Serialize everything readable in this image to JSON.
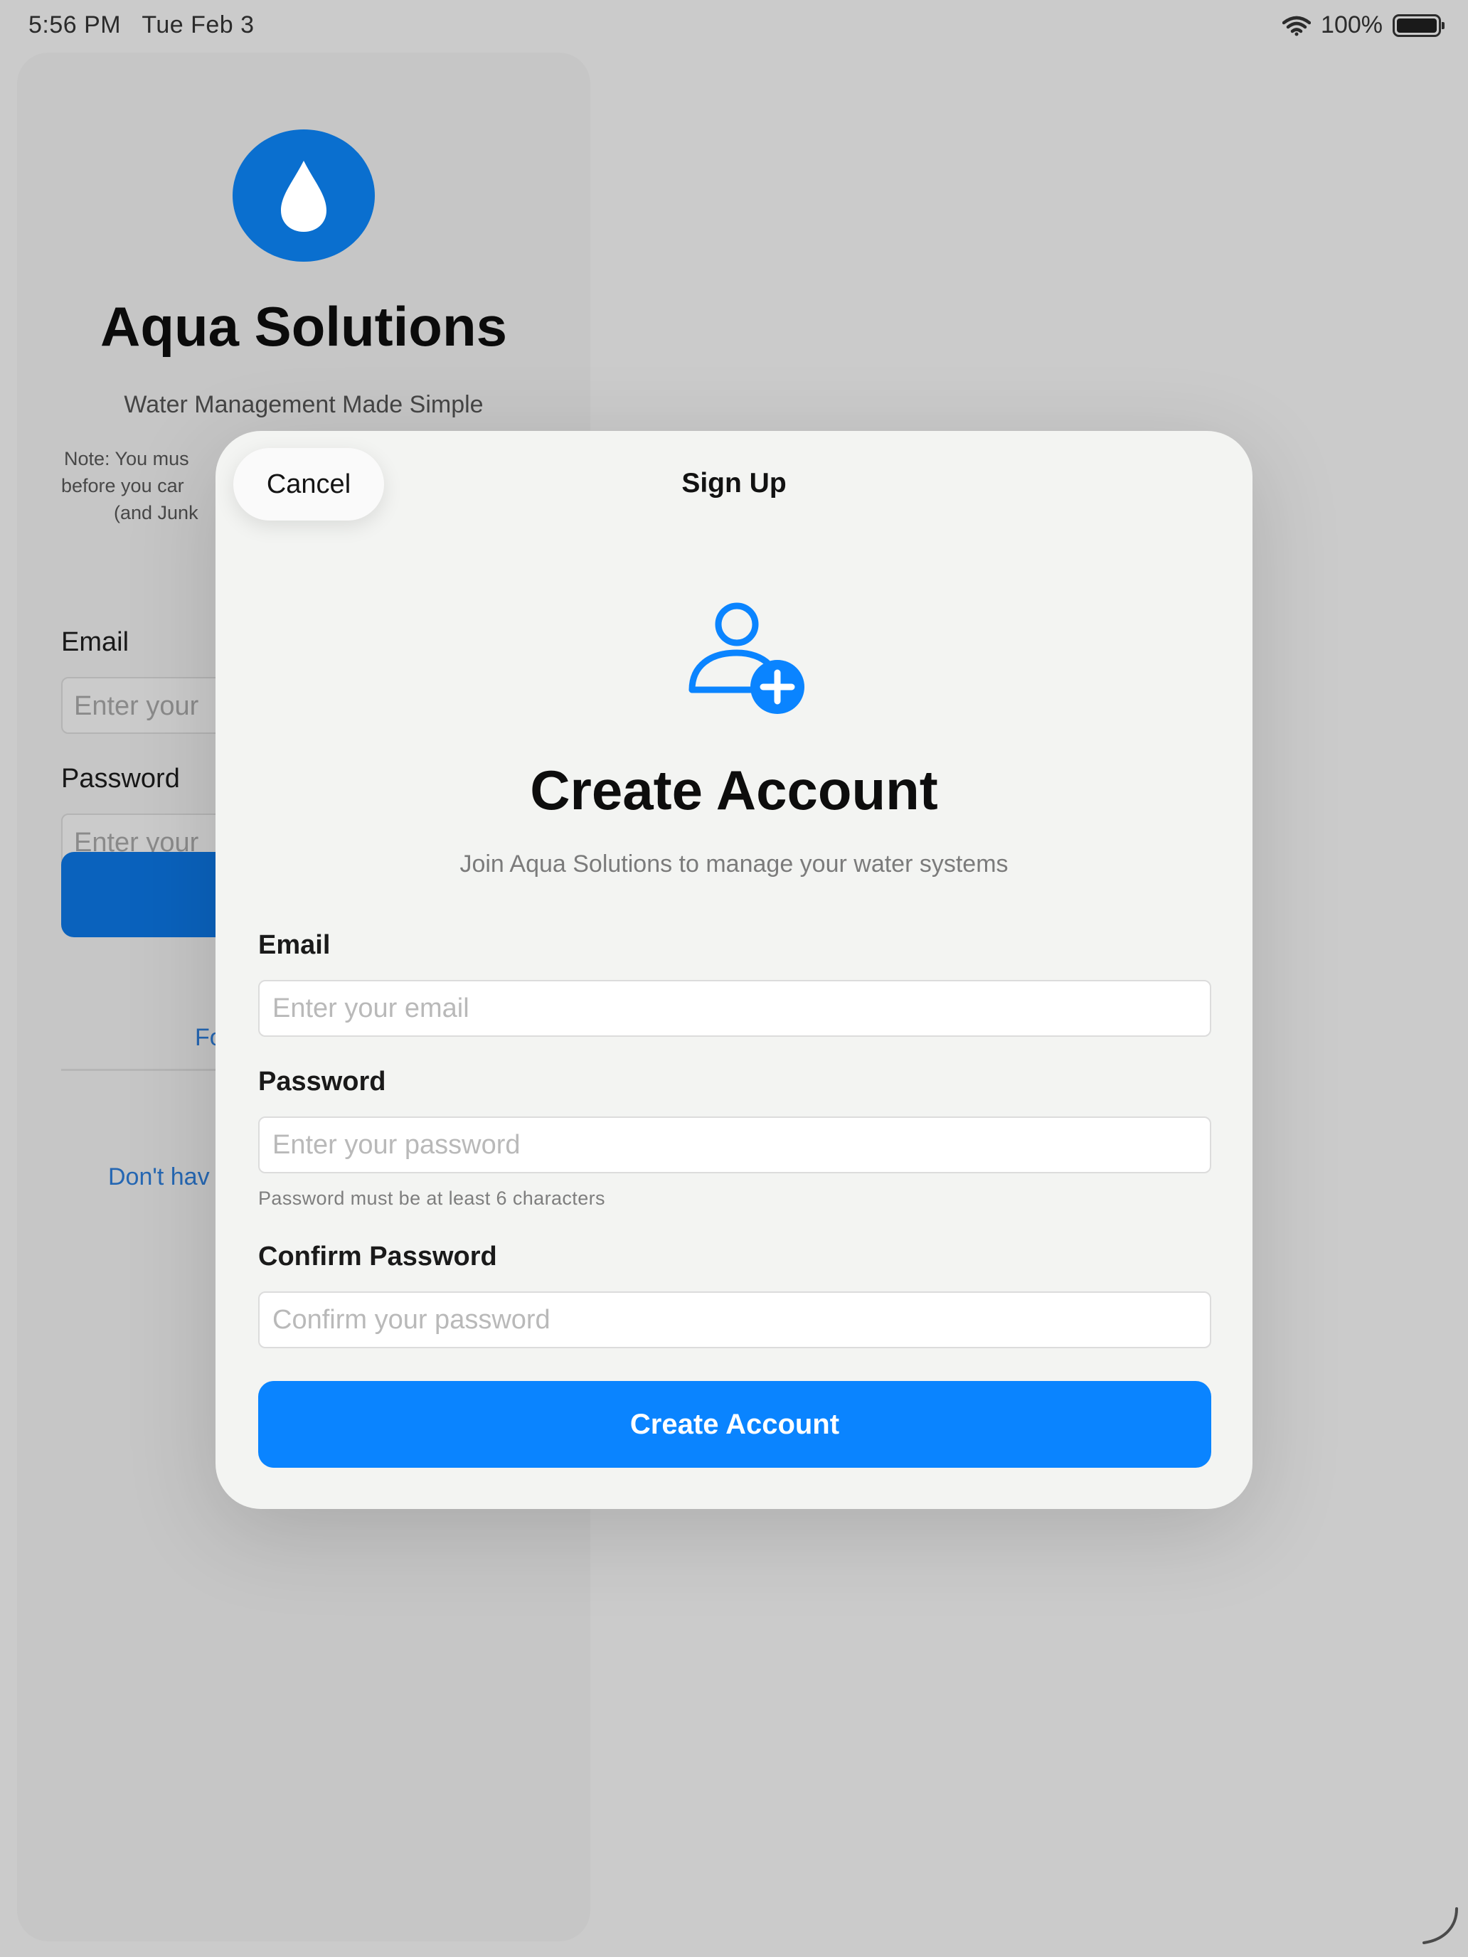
{
  "status_bar": {
    "time": "5:56 PM",
    "date": "Tue Feb 3",
    "battery": "100%"
  },
  "login": {
    "app_title": "Aqua Solutions",
    "subtitle": "Water Management Made Simple",
    "note_lines": [
      "Note: You mus",
      "before you car",
      "(and Junk"
    ],
    "email_label": "Email",
    "email_placeholder": "Enter your",
    "password_label": "Password",
    "password_placeholder": "Enter your",
    "forgot_link": "Fo",
    "signup_link": "Don't hav"
  },
  "signup": {
    "cancel_label": "Cancel",
    "title": "Sign Up",
    "heading": "Create Account",
    "subtitle": "Join Aqua Solutions to manage your water systems",
    "email_label": "Email",
    "email_placeholder": "Enter your email",
    "password_label": "Password",
    "password_placeholder": "Enter your password",
    "password_hint": "Password must be at least 6 characters",
    "confirm_label": "Confirm Password",
    "confirm_placeholder": "Confirm your password",
    "submit_label": "Create Account"
  },
  "colors": {
    "accent": "#0a84ff",
    "logo": "#0a6fcf",
    "link": "#2567b3"
  },
  "icons": {
    "logo": "water-drop-icon",
    "signup": "person-add-icon",
    "wifi": "wifi-icon",
    "battery": "battery-icon"
  }
}
